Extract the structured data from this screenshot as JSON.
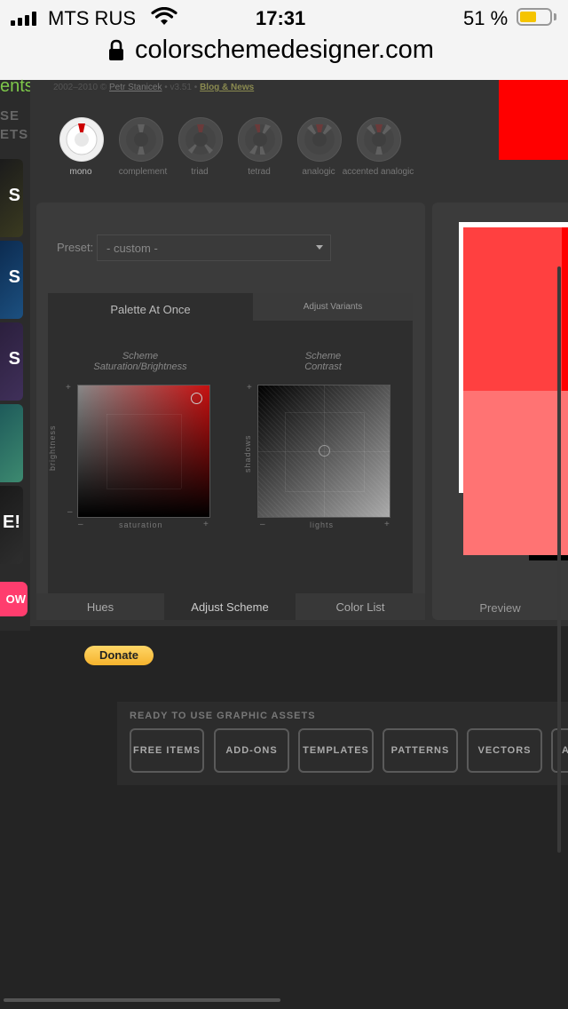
{
  "status_bar": {
    "carrier": "MTS RUS",
    "time": "17:31",
    "battery_percent": "51 %",
    "battery_level": 0.51
  },
  "address_bar": {
    "url": "colorschemedesigner.com"
  },
  "header": {
    "copyright": "2002–2010 ©",
    "author": "Petr Stanicek",
    "version": "• v3.51 •",
    "blog_link": "Blog & News",
    "partial_left_text": "ents"
  },
  "left_ads": {
    "partial_heading_1": "SE",
    "partial_heading_2": "ETS",
    "cards": [
      "S",
      "S",
      "S",
      "",
      "E!"
    ],
    "partial_button": "OW"
  },
  "scheme_types": [
    {
      "label": "mono",
      "selected": true
    },
    {
      "label": "complement",
      "selected": false
    },
    {
      "label": "triad",
      "selected": false
    },
    {
      "label": "tetrad",
      "selected": false
    },
    {
      "label": "analogic",
      "selected": false
    },
    {
      "label": "accented analogic",
      "selected": false
    }
  ],
  "preset": {
    "label": "Preset:",
    "value": "- custom -"
  },
  "tabs": {
    "palette_at_once": "Palette At Once",
    "adjust_variants": "Adjust Variants"
  },
  "scheme_sat_bright": {
    "caption_line1": "Scheme",
    "caption_line2": "Saturation/Brightness",
    "x_axis": "saturation",
    "y_axis": "brightness"
  },
  "scheme_contrast": {
    "caption_line1": "Scheme",
    "caption_line2": "Contrast",
    "x_axis": "lights",
    "y_axis": "shadows"
  },
  "axis_marks": {
    "plus": "+",
    "minus": "–"
  },
  "bottom_tabs": [
    "Hues",
    "Adjust Scheme",
    "Color List"
  ],
  "active_bottom_tab": "Adjust Scheme",
  "preview": {
    "label": "Preview"
  },
  "colors": {
    "primary": "#ff0000",
    "shade_1": "#ff4040",
    "shade_2": "#ff7373",
    "dark": "#000000"
  },
  "donate": {
    "label": "Donate"
  },
  "assets": {
    "title": "READY TO USE GRAPHIC ASSETS",
    "buttons": [
      "FREE ITEMS",
      "ADD-ONS",
      "TEMPLATES",
      "PATTERNS",
      "VECTORS",
      "A"
    ]
  }
}
